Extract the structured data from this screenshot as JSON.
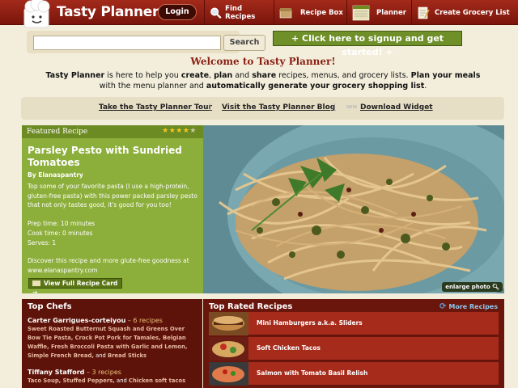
{
  "header": {
    "logo_text": "Tasty Planner",
    "login_label": "Login",
    "nav": [
      {
        "label": "Find Recipes",
        "icon": "magnifier-icon"
      },
      {
        "label": "Recipe Box",
        "icon": "recipe-box-icon"
      },
      {
        "label": "Planner",
        "icon": "planner-icon"
      },
      {
        "label": "Create Grocery List",
        "icon": "grocery-list-icon"
      }
    ]
  },
  "search": {
    "placeholder": "",
    "button_label": "Search"
  },
  "signup": {
    "label": "+ Click here to signup and get started! +"
  },
  "welcome": {
    "title": "Welcome to Tasty Planner!",
    "t1": "Tasty Planner",
    "t2": " is here to help you ",
    "t3": "create",
    "t4": ", ",
    "t5": "plan",
    "t6": " and ",
    "t7": "share",
    "t8": " recipes, menus, and grocery lists. ",
    "t9": "Plan your meals",
    "t10": " with the menu planner and ",
    "t11": "automatically generate your grocery shopping list",
    "t12": "."
  },
  "links": {
    "tour": "Take the Tasty Planner Tour",
    "blog": "Visit the Tasty Planner Blog",
    "new_tag": "NEW",
    "widget": "Download Widget",
    "separator": "|"
  },
  "featured": {
    "header": "Featured Recipe",
    "stars": "★★★★★",
    "rating": 4,
    "title": "Parsley Pesto with Sundried Tomatoes",
    "author": "By Elanaspantry",
    "description": "Top some of your favorite pasta (I use a high-protein, gluten-free pasta) with this power packed parsley pesto that not only tastes good, it's good for you too!",
    "prep_time": "Prep time: 10 minutes",
    "cook_time": "Cook time: 0 minutes",
    "serves": "Serves: 1",
    "more": "Discover this recipe and more glute-free goodness at www.elanaspantry.com",
    "view_button": "View Full Recipe Card →",
    "enlarge": "enlarge photo"
  },
  "top_chefs": {
    "title": "Top Chefs",
    "chefs": [
      {
        "name": "Carter Garrigues-corteiyou",
        "count": " – 6 recipes",
        "recipes": "Sweet Roasted Butternut Squash and Greens Over Bow Tie Pasta, Crock Pot Pork for Tamales, Belgian Waffle, Fresh Broccoli Pasta with Garlic and Lemon, Simple French Bread,",
        "and": " and ",
        "last": "Bread Sticks"
      },
      {
        "name": "Tiffany Stafford",
        "count": " – 3 recipes",
        "recipes": "Taco Soup, Stuffed Peppers,",
        "and": " and ",
        "last": "Chicken soft tacos"
      }
    ]
  },
  "top_rated": {
    "title": "Top Rated Recipes",
    "more": "More Recipes",
    "items": [
      {
        "label": "Mini Hamburgers a.k.a. Sliders"
      },
      {
        "label": "Soft Chicken Tacos"
      },
      {
        "label": "Salmon with Tomato Basil Relish"
      }
    ]
  },
  "colors": {
    "brand_red": "#8b1e12",
    "featured_green": "#8cae3a",
    "dark_maroon": "#5d1309",
    "background": "#f3eedc"
  }
}
